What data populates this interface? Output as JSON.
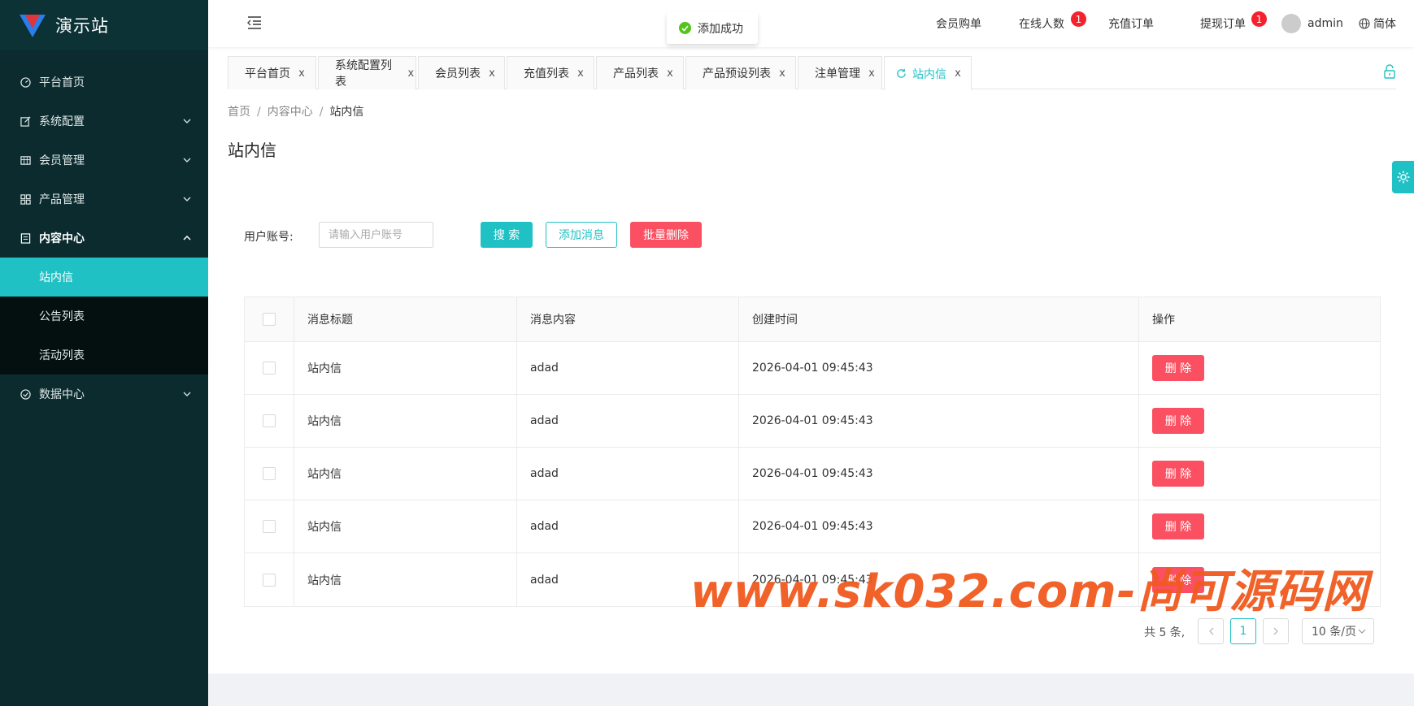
{
  "app": {
    "title": "演示站"
  },
  "sidebar": {
    "items": [
      {
        "label": "平台首页",
        "icon": "dashboard-icon"
      },
      {
        "label": "系统配置",
        "icon": "edit-icon"
      },
      {
        "label": "会员管理",
        "icon": "table-icon"
      },
      {
        "label": "产品管理",
        "icon": "grid-icon"
      },
      {
        "label": "内容中心",
        "icon": "document-icon"
      },
      {
        "label": "数据中心",
        "icon": "check-circle-icon"
      }
    ],
    "submenu": [
      {
        "label": "站内信"
      },
      {
        "label": "公告列表"
      },
      {
        "label": "活动列表"
      }
    ]
  },
  "header": {
    "toast": "添加成功",
    "nav": {
      "member_orders": "会员购单",
      "online_users": "在线人数",
      "online_badge": "1",
      "recharge_orders": "充值订单",
      "withdraw_orders": "提现订单",
      "withdraw_badge": "1",
      "user": "admin",
      "language": "简体"
    }
  },
  "tabs": [
    {
      "label": "平台首页"
    },
    {
      "label": "系统配置列表"
    },
    {
      "label": "会员列表"
    },
    {
      "label": "充值列表"
    },
    {
      "label": "产品列表"
    },
    {
      "label": "产品预设列表"
    },
    {
      "label": "注单管理"
    },
    {
      "label": "站内信"
    }
  ],
  "tab_close": "x",
  "breadcrumb": {
    "home": "首页",
    "section": "内容中心",
    "current": "站内信",
    "sep": "/"
  },
  "page": {
    "title": "站内信"
  },
  "search": {
    "label": "用户账号:",
    "placeholder": "请输入用户账号",
    "search_btn": "搜 索",
    "add_btn": "添加消息",
    "batch_delete_btn": "批量删除"
  },
  "table": {
    "columns": [
      "消息标题",
      "消息内容",
      "创建时间",
      "操作"
    ],
    "rows": [
      {
        "title": "站内信",
        "content": "adad",
        "created": "2026-04-01 09:45:43",
        "action": "删 除"
      },
      {
        "title": "站内信",
        "content": "adad",
        "created": "2026-04-01 09:45:43",
        "action": "删 除"
      },
      {
        "title": "站内信",
        "content": "adad",
        "created": "2026-04-01 09:45:43",
        "action": "删 除"
      },
      {
        "title": "站内信",
        "content": "adad",
        "created": "2026-04-01 09:45:43",
        "action": "删 除"
      },
      {
        "title": "站内信",
        "content": "adad",
        "created": "2026-04-01 09:45:43",
        "action": "删 除"
      }
    ]
  },
  "pagination": {
    "total": "共 5 条,",
    "current_page": "1",
    "page_size": "10 条/页"
  },
  "watermark": "www.sk032.com-尚可源码网",
  "colors": {
    "accent": "#20c1c4",
    "danger": "#fa5061",
    "sidebar": "#0b2b2e"
  }
}
